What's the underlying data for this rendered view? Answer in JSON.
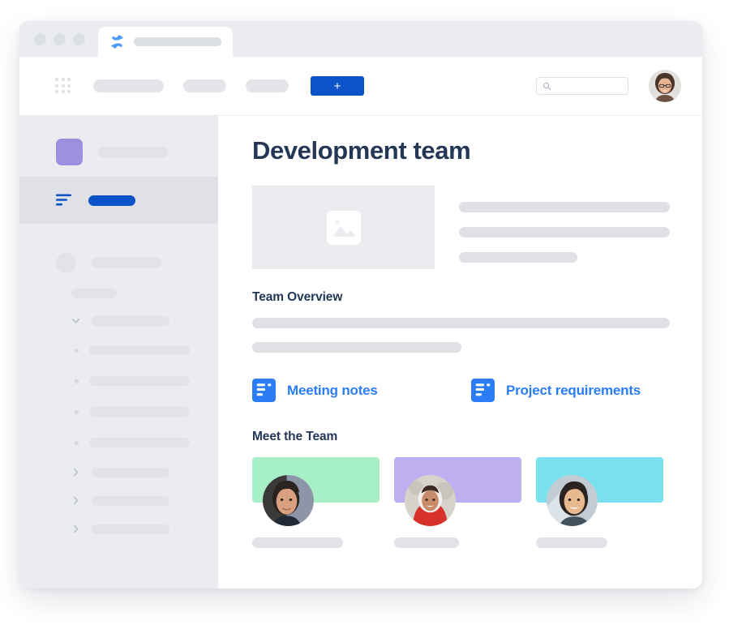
{
  "browser": {
    "window_dots": [
      "close-dot",
      "minimize-dot",
      "maximize-dot"
    ],
    "tab": {
      "favicon": "confluence-logo-icon",
      "title_placeholder": ""
    }
  },
  "topbar": {
    "app_switcher_icon": "app-switcher-grid-icon",
    "nav_placeholders": [
      "",
      "",
      ""
    ],
    "create_label": "+",
    "create_color": "#0C53CA",
    "search": {
      "icon": "search-icon",
      "value": "",
      "placeholder": ""
    },
    "avatar": "user-avatar"
  },
  "sidebar": {
    "background": "#EBECF0",
    "space": {
      "avatar_color": "#9F8FE0",
      "name_placeholder": ""
    },
    "selected_item": {
      "icon": "content-lines-icon",
      "label_placeholder": "",
      "accent_color": "#0C53CA",
      "highlight_color": "#DFE1E6"
    },
    "items": [
      {
        "icon": "circle-avatar-icon",
        "label_placeholder": "",
        "type": "avatar-row"
      },
      {
        "icon": "",
        "label_placeholder": "",
        "type": "short-row"
      },
      {
        "icon": "chevron-down-icon",
        "label_placeholder": "",
        "type": "expanded-row"
      },
      {
        "icon": "bullet-icon",
        "label_placeholder": "",
        "type": "child-row"
      },
      {
        "icon": "bullet-icon",
        "label_placeholder": "",
        "type": "child-row"
      },
      {
        "icon": "bullet-icon",
        "label_placeholder": "",
        "type": "child-row"
      },
      {
        "icon": "bullet-icon",
        "label_placeholder": "",
        "type": "child-row"
      },
      {
        "icon": "chevron-right-icon",
        "label_placeholder": "",
        "type": "collapsed-row"
      },
      {
        "icon": "chevron-right-icon",
        "label_placeholder": "",
        "type": "collapsed-row"
      },
      {
        "icon": "chevron-right-icon",
        "label_placeholder": "",
        "type": "collapsed-row"
      }
    ]
  },
  "main": {
    "page_title": "Development team",
    "title_color": "#243757",
    "hero": {
      "image_icon": "image-placeholder-icon",
      "text_lines": [
        100,
        100,
        56
      ]
    },
    "overview": {
      "heading": "Team Overview",
      "text_lines": [
        100,
        50
      ]
    },
    "links": [
      {
        "icon": "page-document-icon",
        "label": "Meeting notes",
        "color": "#2B7DF6"
      },
      {
        "icon": "page-document-icon",
        "label": "Project requirements",
        "color": "#2B7DF6"
      }
    ],
    "team": {
      "heading": "Meet the Team",
      "members": [
        {
          "banner_color": "#A7EFC7",
          "avatar": "team-member-avatar-1",
          "name_placeholder": ""
        },
        {
          "banner_color": "#BEB0F0",
          "avatar": "team-member-avatar-2",
          "name_placeholder": ""
        },
        {
          "banner_color": "#79E0EE",
          "avatar": "team-member-avatar-3",
          "name_placeholder": ""
        }
      ]
    }
  }
}
